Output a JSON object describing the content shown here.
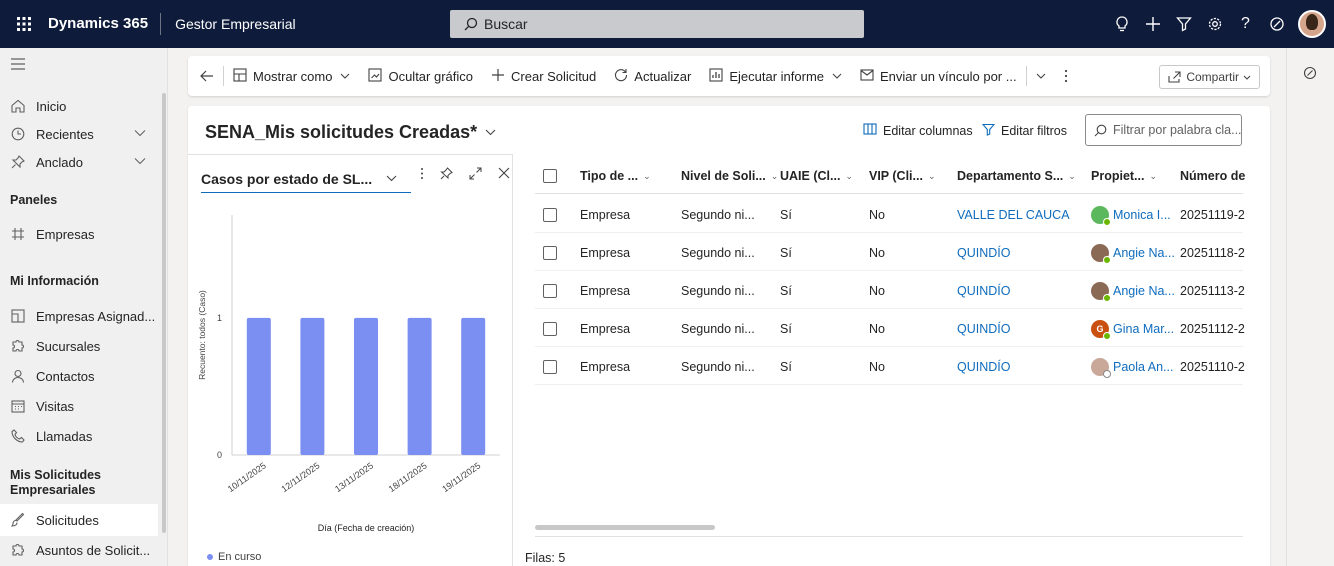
{
  "topbar": {
    "app_name": "Dynamics 365",
    "sub_app": "Gestor Empresarial",
    "search_placeholder": "Buscar"
  },
  "sidebar": {
    "items": [
      {
        "label": "Inicio",
        "icon": "home-icon"
      },
      {
        "label": "Recientes",
        "icon": "clock-icon"
      },
      {
        "label": "Anclado",
        "icon": "pin-icon"
      }
    ],
    "sections": {
      "paneles": "Paneles",
      "mi_info": "Mi Información",
      "mis_solicitudes": "Mis Solicitudes Empresariales"
    },
    "paneles_items": [
      {
        "label": "Empresas",
        "icon": "grid-icon"
      }
    ],
    "mi_info_items": [
      {
        "label": "Empresas Asignad...",
        "icon": "building-icon"
      },
      {
        "label": "Sucursales",
        "icon": "puzzle-icon"
      },
      {
        "label": "Contactos",
        "icon": "person-icon"
      },
      {
        "label": "Visitas",
        "icon": "calendar-icon"
      },
      {
        "label": "Llamadas",
        "icon": "phone-icon"
      }
    ],
    "solicitudes_items": [
      {
        "label": "Solicitudes",
        "icon": "brush-icon"
      },
      {
        "label": "Asuntos de Solicit...",
        "icon": "puzzle-icon"
      }
    ]
  },
  "commands": {
    "mostrar_como": "Mostrar como",
    "ocultar_grafico": "Ocultar gráfico",
    "crear_solicitud": "Crear Solicitud",
    "actualizar": "Actualizar",
    "ejecutar_informe": "Ejecutar informe",
    "enviar_vinculo": "Enviar un vínculo por ...",
    "compartir": "Compartir"
  },
  "view": {
    "title": "SENA_Mis solicitudes Creadas*",
    "editar_columnas": "Editar columnas",
    "editar_filtros": "Editar filtros",
    "filter_placeholder": "Filtrar por palabra cla..."
  },
  "chart_panel": {
    "selector_label": "Casos por estado de SL...",
    "legend": "En curso"
  },
  "chart_data": {
    "type": "bar",
    "categories": [
      "10/11/2025",
      "12/11/2025",
      "13/11/2025",
      "18/11/2025",
      "19/11/2025"
    ],
    "values": [
      1,
      1,
      1,
      1,
      1
    ],
    "xlabel": "Día (Fecha de creación)",
    "ylabel": "Recuento: todos (Caso)",
    "ylim": [
      0,
      1.75
    ],
    "yticks": [
      0,
      1
    ],
    "series": [
      {
        "name": "En curso",
        "values": [
          1,
          1,
          1,
          1,
          1
        ],
        "color": "#7b8ef2"
      }
    ]
  },
  "grid": {
    "columns": [
      "Tipo de ...",
      "Nivel de Soli...",
      "UAIE (Cl...",
      "VIP (Cli...",
      "Departamento S...",
      "Propiet...",
      "Número de"
    ],
    "rows": [
      {
        "tipo": "Empresa",
        "nivel": "Segundo ni...",
        "uaie": "Sí",
        "vip": "No",
        "departamento": "VALLE DEL CAUCA",
        "propietario": "Monica I...",
        "numero": "20251119-2",
        "avatar_color": "#5cb85c",
        "avatar_initial": "",
        "presence": "#6bb700"
      },
      {
        "tipo": "Empresa",
        "nivel": "Segundo ni...",
        "uaie": "Sí",
        "vip": "No",
        "departamento": "QUINDÍO",
        "propietario": "Angie Na...",
        "numero": "20251118-2",
        "avatar_color": "#8a6a55",
        "avatar_initial": "",
        "presence": "#6bb700"
      },
      {
        "tipo": "Empresa",
        "nivel": "Segundo ni...",
        "uaie": "Sí",
        "vip": "No",
        "departamento": "QUINDÍO",
        "propietario": "Angie Na...",
        "numero": "20251113-2",
        "avatar_color": "#8a6a55",
        "avatar_initial": "",
        "presence": "#6bb700"
      },
      {
        "tipo": "Empresa",
        "nivel": "Segundo ni...",
        "uaie": "Sí",
        "vip": "No",
        "departamento": "QUINDÍO",
        "propietario": "Gina Mar...",
        "numero": "20251112-2",
        "avatar_color": "#ca5010",
        "avatar_initial": "G",
        "presence": "#6bb700"
      },
      {
        "tipo": "Empresa",
        "nivel": "Segundo ni...",
        "uaie": "Sí",
        "vip": "No",
        "departamento": "QUINDÍO",
        "propietario": "Paola An...",
        "numero": "20251110-2",
        "avatar_color": "#c9a89a",
        "avatar_initial": "",
        "presence": "#ffffff"
      }
    ],
    "rows_count": "Filas: 5"
  }
}
